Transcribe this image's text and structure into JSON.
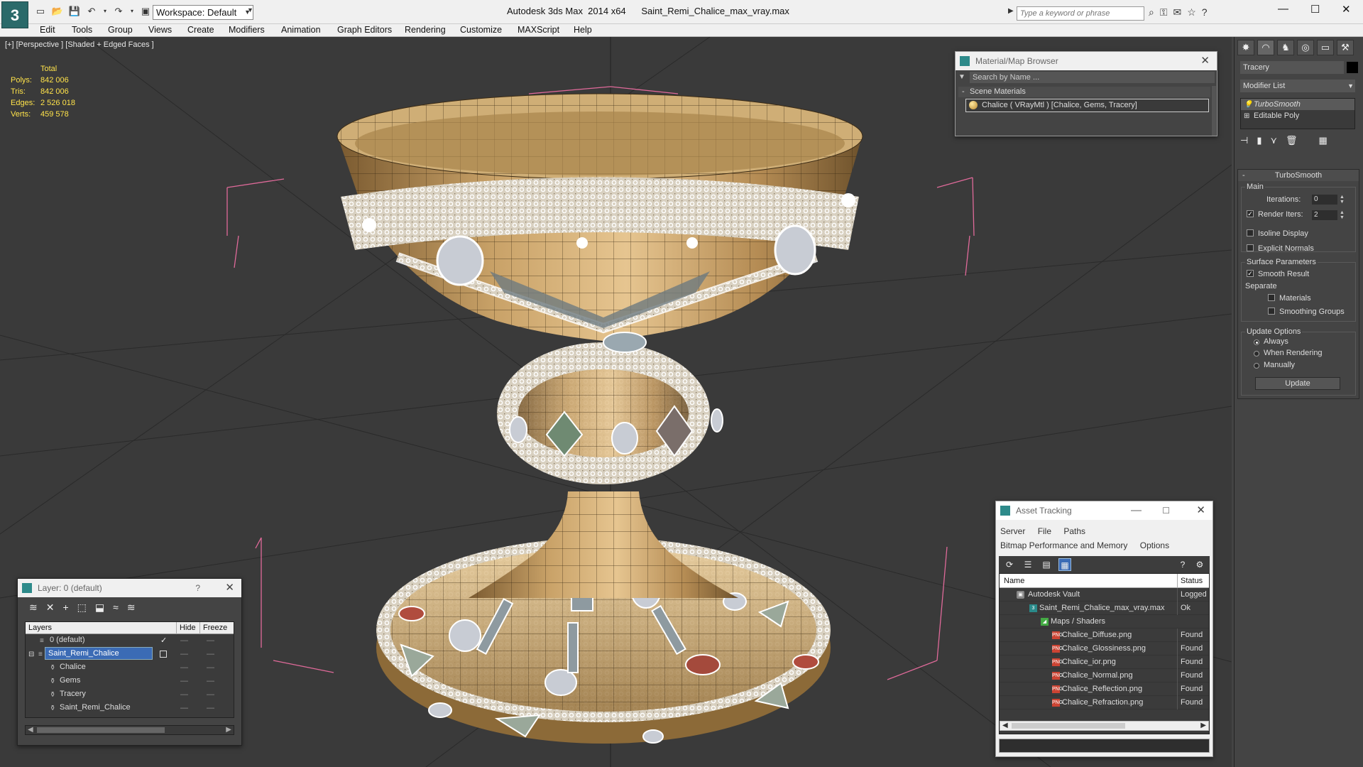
{
  "app": {
    "title": "Autodesk 3ds Max  2014 x64      Saint_Remi_Chalice_max_vray.max",
    "logo_glyph": "3",
    "workspace": "Workspace: Default",
    "search_placeholder": "Type a keyword or phrase"
  },
  "menu": [
    "Edit",
    "Tools",
    "Group",
    "Views",
    "Create",
    "Modifiers",
    "Animation",
    "Graph Editors",
    "Rendering",
    "Customize",
    "MAXScript",
    "Help"
  ],
  "viewport": {
    "label": "[+] [Perspective ] [Shaded + Edged Faces ]",
    "stats": {
      "header": "Total",
      "rows": [
        {
          "k": "Polys:",
          "v": "842 006"
        },
        {
          "k": "Tris:",
          "v": "842 006"
        },
        {
          "k": "Edges:",
          "v": "2 526 018"
        },
        {
          "k": "Verts:",
          "v": "459 578"
        }
      ]
    }
  },
  "material_browser": {
    "title": "Material/Map Browser",
    "search": "Search by Name ...",
    "section": "Scene Materials",
    "item": "Chalice  ( VRayMtl )  [Chalice, Gems, Tracery]"
  },
  "command_panel": {
    "object_name": "Tracery",
    "object_color": "#000000",
    "modifier_list": "Modifier List",
    "stack": [
      "TurboSmooth",
      "Editable Poly"
    ],
    "turbosmooth": {
      "title": "TurboSmooth",
      "main": "Main",
      "iterations_label": "Iterations:",
      "iterations": "0",
      "render_iters_label": "Render Iters:",
      "render_iters": "2",
      "isoline": "Isoline Display",
      "explicit_normals": "Explicit Normals",
      "surface_params": "Surface Parameters",
      "smooth_result": "Smooth Result",
      "separate": "Separate",
      "materials": "Materials",
      "smoothing_groups": "Smoothing Groups",
      "update_options": "Update Options",
      "always": "Always",
      "when_rendering": "When Rendering",
      "manually": "Manually",
      "update_btn": "Update"
    }
  },
  "layer_panel": {
    "title": "Layer: 0 (default)",
    "col_layers": "Layers",
    "col_hide": "Hide",
    "col_freeze": "Freeze",
    "rows": [
      {
        "name": "0 (default)",
        "indent": 0
      },
      {
        "name": "Saint_Remi_Chalice",
        "indent": 0
      },
      {
        "name": "Chalice",
        "indent": 1
      },
      {
        "name": "Gems",
        "indent": 1
      },
      {
        "name": "Tracery",
        "indent": 1
      },
      {
        "name": "Saint_Remi_Chalice",
        "indent": 1
      }
    ]
  },
  "asset_tracking": {
    "title": "Asset Tracking",
    "menu1": [
      "Server",
      "File",
      "Paths"
    ],
    "menu2": [
      "Bitmap Performance and Memory",
      "Options"
    ],
    "col_name": "Name",
    "col_status": "Status",
    "rows": [
      {
        "name": "Autodesk Vault",
        "status": "Logged",
        "indent": 1,
        "icon": "vault"
      },
      {
        "name": "Saint_Remi_Chalice_max_vray.max",
        "status": "Ok",
        "indent": 2,
        "icon": "max"
      },
      {
        "name": "Maps / Shaders",
        "status": "",
        "indent": 3,
        "icon": "maps"
      },
      {
        "name": "Chalice_Diffuse.png",
        "status": "Found",
        "indent": 4,
        "icon": "png"
      },
      {
        "name": "Chalice_Glossiness.png",
        "status": "Found",
        "indent": 4,
        "icon": "png"
      },
      {
        "name": "Chalice_ior.png",
        "status": "Found",
        "indent": 4,
        "icon": "png"
      },
      {
        "name": "Chalice_Normal.png",
        "status": "Found",
        "indent": 4,
        "icon": "png"
      },
      {
        "name": "Chalice_Reflection.png",
        "status": "Found",
        "indent": 4,
        "icon": "png"
      },
      {
        "name": "Chalice_Refraction.png",
        "status": "Found",
        "indent": 4,
        "icon": "png"
      }
    ]
  },
  "colors": {
    "accent": "#3b6bb5",
    "stats_text": "#ffe34a",
    "viewport_bg": "#3a3a3a"
  }
}
